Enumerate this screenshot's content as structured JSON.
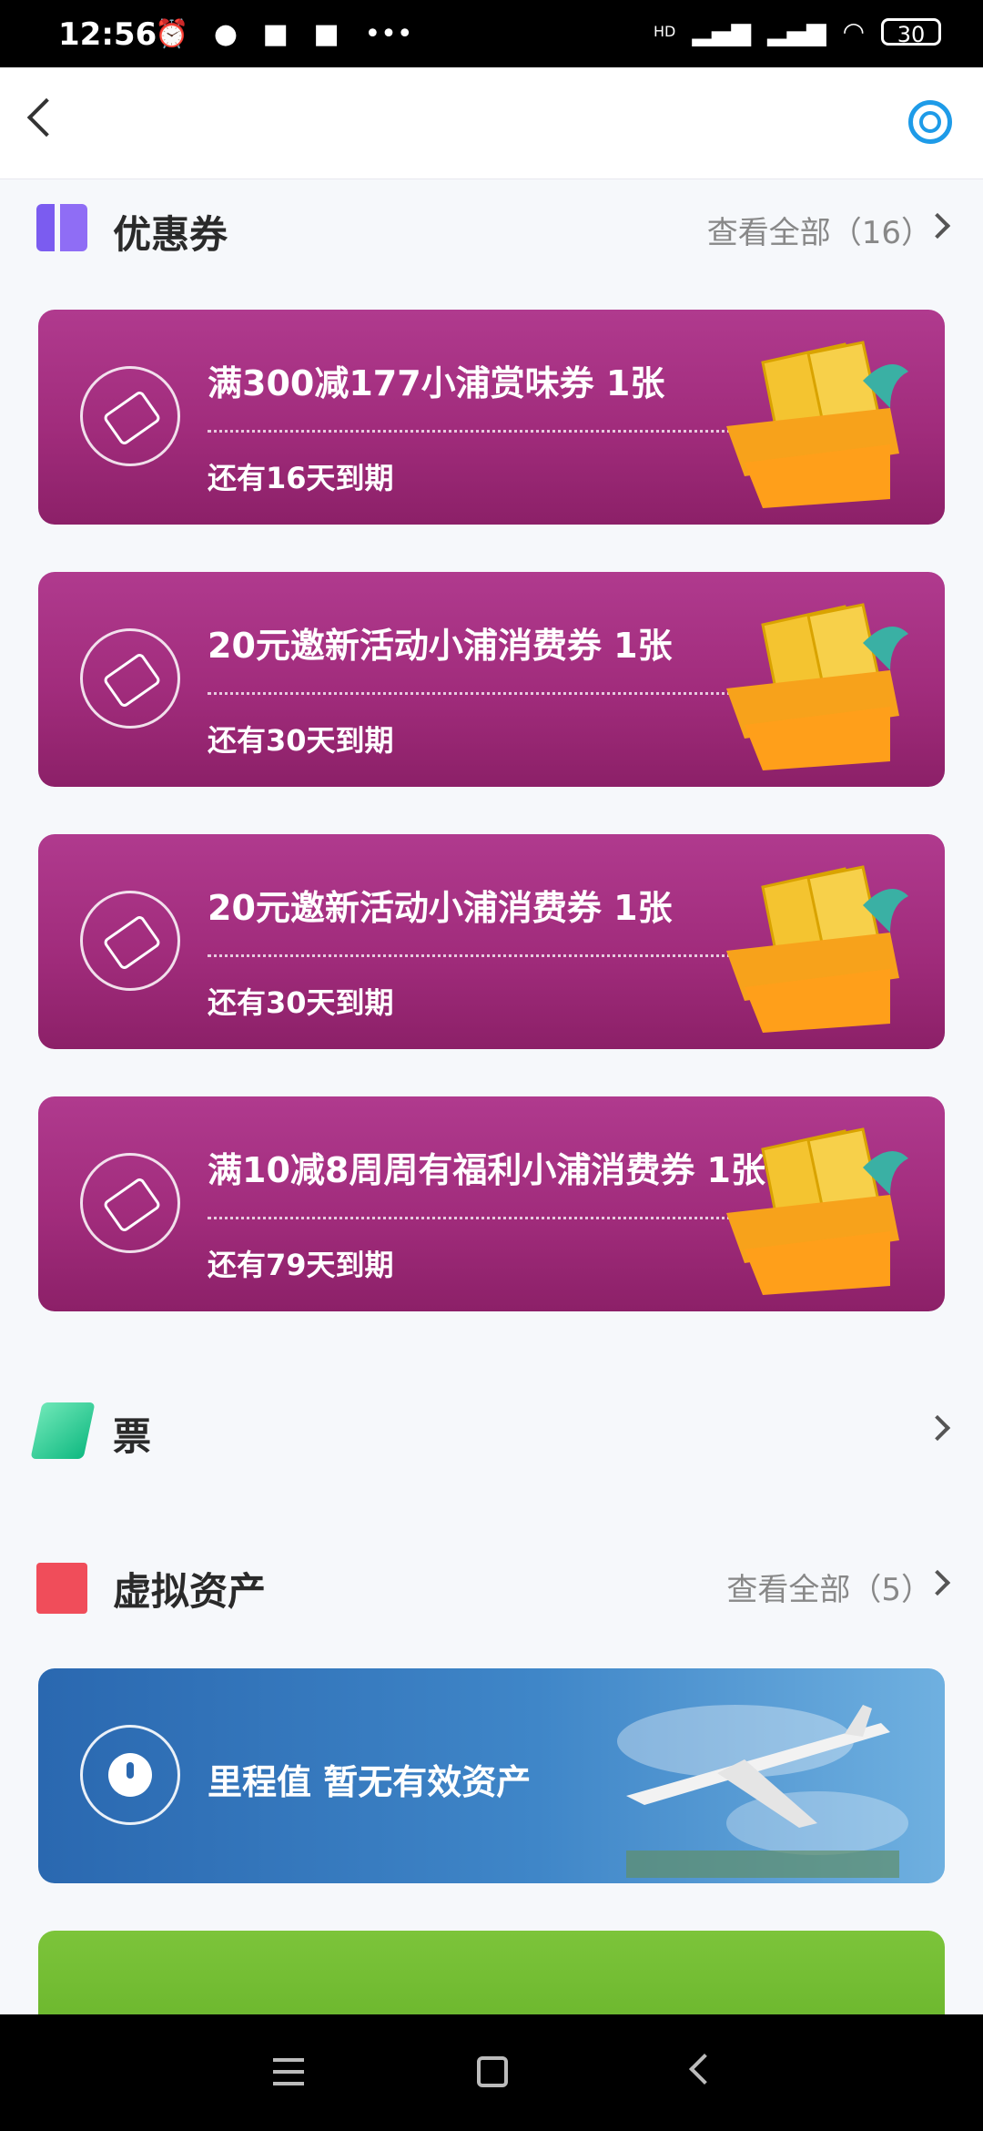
{
  "status_bar": {
    "time": "12:56",
    "battery": "30",
    "network": "HD"
  },
  "coupons": {
    "title": "优惠券",
    "view_all": "查看全部（16）",
    "items": [
      {
        "title": "满300减177小浦赏味券 1张",
        "expiry": "还有16天到期"
      },
      {
        "title": "20元邀新活动小浦消费券 1张",
        "expiry": "还有30天到期"
      },
      {
        "title": "20元邀新活动小浦消费券 1张",
        "expiry": "还有30天到期"
      },
      {
        "title": "满10减8周周有福利小浦消费券 1张",
        "expiry": "还有79天到期"
      }
    ]
  },
  "tickets": {
    "title": "票"
  },
  "virtual_assets": {
    "title": "虚拟资产",
    "view_all": "查看全部（5）",
    "mileage": {
      "label": "里程值 暂无有效资产"
    }
  },
  "colors": {
    "coupon_card": "#a12c7c",
    "mileage_card": "#2a68b0",
    "accent_ring": "#1e9be8",
    "asset_icon": "#f04d5a"
  }
}
